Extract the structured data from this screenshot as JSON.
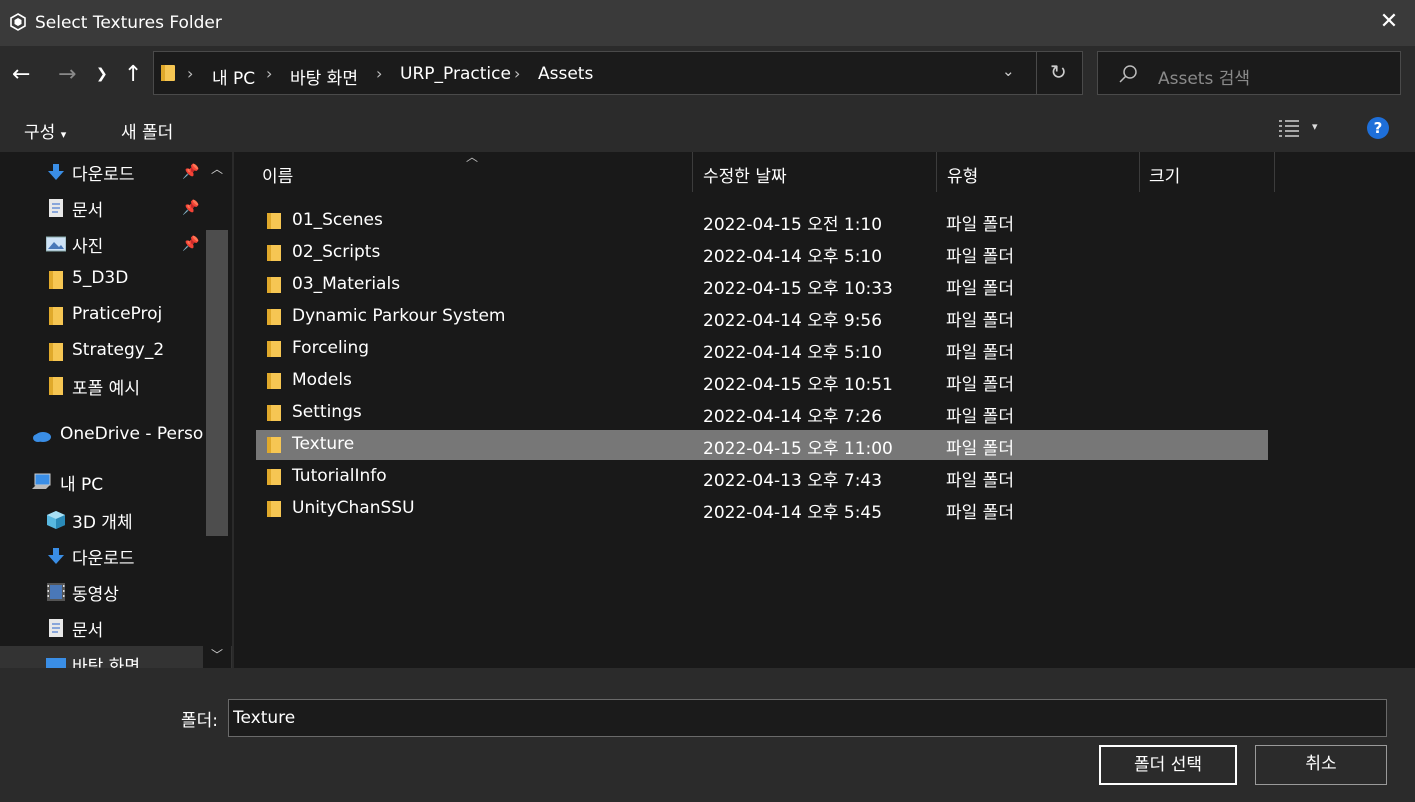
{
  "window": {
    "title": "Select Textures Folder"
  },
  "nav": {
    "breadcrumbs": [
      "내 PC",
      "바탕 화면",
      "URP_Practice",
      "Assets"
    ],
    "search_placeholder": "Assets 검색"
  },
  "toolbar": {
    "organize": "구성",
    "new_folder": "새 폴더"
  },
  "sidebar": {
    "items": [
      {
        "label": "다운로드",
        "icon": "download-icon",
        "pinned": true
      },
      {
        "label": "문서",
        "icon": "document-icon",
        "pinned": true
      },
      {
        "label": "사진",
        "icon": "pictures-icon",
        "pinned": true
      },
      {
        "label": "5_D3D",
        "icon": "folder-icon",
        "pinned": false
      },
      {
        "label": "PraticeProj",
        "icon": "folder-icon",
        "pinned": false
      },
      {
        "label": "Strategy_2",
        "icon": "folder-icon",
        "pinned": false
      },
      {
        "label": "포폴 예시",
        "icon": "folder-icon",
        "pinned": false
      },
      {
        "label": "OneDrive - Persor",
        "icon": "cloud-icon",
        "pinned": false
      },
      {
        "label": "내 PC",
        "icon": "computer-icon",
        "pinned": false
      },
      {
        "label": "3D 개체",
        "icon": "3d-objects-icon",
        "pinned": false
      },
      {
        "label": "다운로드",
        "icon": "download-icon",
        "pinned": false
      },
      {
        "label": "동영상",
        "icon": "video-icon",
        "pinned": false
      },
      {
        "label": "문서",
        "icon": "document-icon",
        "pinned": false
      },
      {
        "label": "바탕 화면",
        "icon": "desktop-icon",
        "pinned": false
      }
    ]
  },
  "columns": {
    "name": "이름",
    "modified": "수정한 날짜",
    "type": "유형",
    "size": "크기"
  },
  "files": [
    {
      "name": "01_Scenes",
      "modified": "2022-04-15 오전 1:10",
      "type": "파일 폴더"
    },
    {
      "name": "02_Scripts",
      "modified": "2022-04-14 오후 5:10",
      "type": "파일 폴더"
    },
    {
      "name": "03_Materials",
      "modified": "2022-04-15 오후 10:33",
      "type": "파일 폴더"
    },
    {
      "name": "Dynamic Parkour System",
      "modified": "2022-04-14 오후 9:56",
      "type": "파일 폴더"
    },
    {
      "name": "Forceling",
      "modified": "2022-04-14 오후 5:10",
      "type": "파일 폴더"
    },
    {
      "name": "Models",
      "modified": "2022-04-15 오후 10:51",
      "type": "파일 폴더"
    },
    {
      "name": "Settings",
      "modified": "2022-04-14 오후 7:26",
      "type": "파일 폴더"
    },
    {
      "name": "Texture",
      "modified": "2022-04-15 오후 11:00",
      "type": "파일 폴더",
      "selected": true
    },
    {
      "name": "TutorialInfo",
      "modified": "2022-04-13 오후 7:43",
      "type": "파일 폴더"
    },
    {
      "name": "UnityChanSSU",
      "modified": "2022-04-14 오후 5:45",
      "type": "파일 폴더"
    }
  ],
  "footer": {
    "folder_label": "폴더:",
    "folder_value": "Texture",
    "select_button": "폴더 선택",
    "cancel_button": "취소"
  }
}
